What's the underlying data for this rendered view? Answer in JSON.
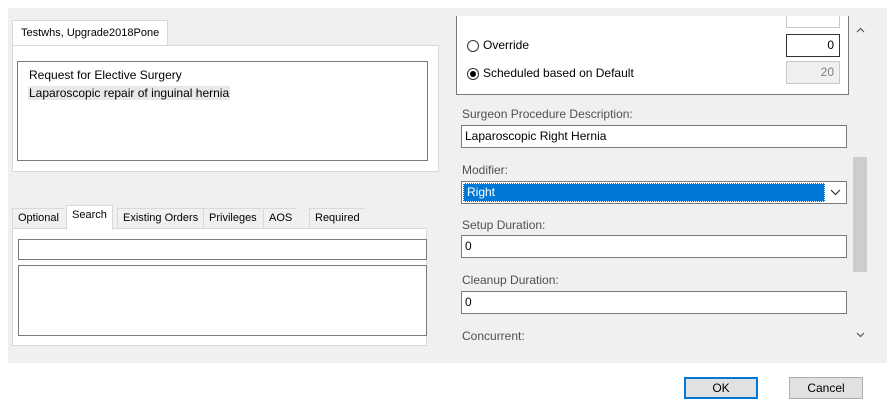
{
  "patient": {
    "tab_label": "Testwhs, Upgrade2018Pone"
  },
  "orders": {
    "items": [
      "Request for Elective Surgery",
      "Laparoscopic repair of inguinal hernia"
    ]
  },
  "tabs": {
    "optional": "Optional",
    "search": "Search",
    "existing_orders": "Existing Orders",
    "privileges": "Privileges",
    "aos": "AOS",
    "required": "Required",
    "active": "Search"
  },
  "search": {
    "value": ""
  },
  "schedule": {
    "override_label": "Override",
    "override_value": "0",
    "override_selected": false,
    "default_label": "Scheduled based on Default",
    "default_value": "20",
    "default_selected": true
  },
  "fields": {
    "surgeon_desc_label": "Surgeon Procedure Description:",
    "surgeon_desc_value": "Laparoscopic Right Hernia",
    "modifier_label": "Modifier:",
    "modifier_value": "Right",
    "setup_label": "Setup Duration:",
    "setup_value": "0",
    "cleanup_label": "Cleanup Duration:",
    "cleanup_value": "0",
    "concurrent_label": "Concurrent:"
  },
  "icons": {
    "modifier_dropdown": "chevron-down-icon",
    "scroll_up": "arrow-up-icon",
    "scroll_down": "arrow-down-icon"
  },
  "buttons": {
    "ok": "OK",
    "cancel": "Cancel"
  },
  "colors": {
    "selection": "#0078d7",
    "default_button_border": "#0078d7"
  }
}
